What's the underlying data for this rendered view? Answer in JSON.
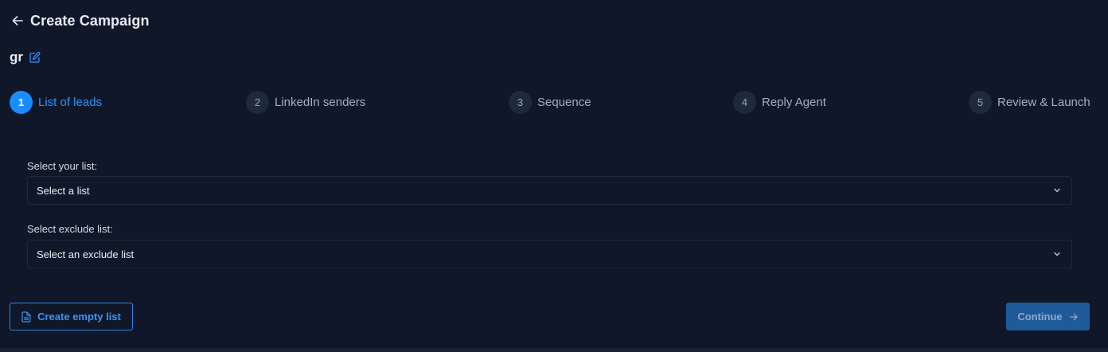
{
  "header": {
    "title": "Create Campaign"
  },
  "campaign": {
    "name": "gr"
  },
  "steps": [
    {
      "number": "1",
      "label": "List of leads",
      "active": true
    },
    {
      "number": "2",
      "label": "LinkedIn senders",
      "active": false
    },
    {
      "number": "3",
      "label": "Sequence",
      "active": false
    },
    {
      "number": "4",
      "label": "Reply Agent",
      "active": false
    },
    {
      "number": "5",
      "label": "Review & Launch",
      "active": false
    }
  ],
  "form": {
    "list_label": "Select your list:",
    "list_value": "Select a list",
    "exclude_label": "Select exclude list:",
    "exclude_value": "Select an exclude list"
  },
  "actions": {
    "create_empty_list": "Create empty list",
    "continue": "Continue"
  },
  "icons": {
    "back": "arrow-left-icon",
    "edit": "edit-icon",
    "chevron": "chevron-down-icon",
    "document": "document-icon",
    "arrow_right": "arrow-right-icon"
  },
  "colors": {
    "background": "#0f1729",
    "accent": "#1a8cff",
    "step_inactive": "#1e293b",
    "primary_button": "#1f5a99"
  }
}
